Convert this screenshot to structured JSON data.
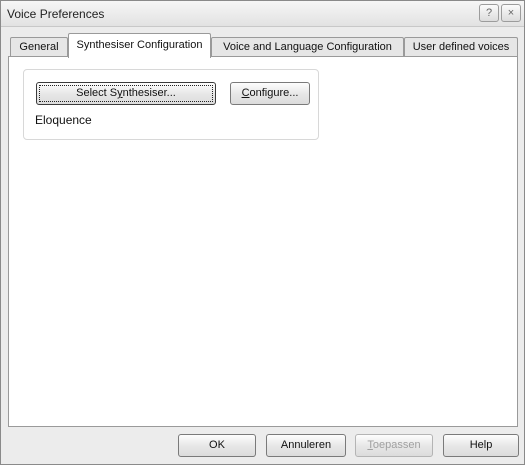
{
  "window": {
    "title": "Voice Preferences",
    "help_glyph": "?",
    "close_glyph": "×"
  },
  "tabs": [
    {
      "label": "General"
    },
    {
      "label": "Synthesiser Configuration",
      "selected": true
    },
    {
      "label": "Voice and Language Configuration"
    },
    {
      "label": "User defined voices"
    }
  ],
  "synth": {
    "select_pre": "Select S",
    "select_acc": "y",
    "select_post": "nthesiser...",
    "configure_acc": "C",
    "configure_post": "onfigure...",
    "current_synth": "Eloquence"
  },
  "footer": {
    "ok": "OK",
    "cancel": "Annuleren",
    "apply_acc": "T",
    "apply_post": "oepassen",
    "help": "Help"
  }
}
